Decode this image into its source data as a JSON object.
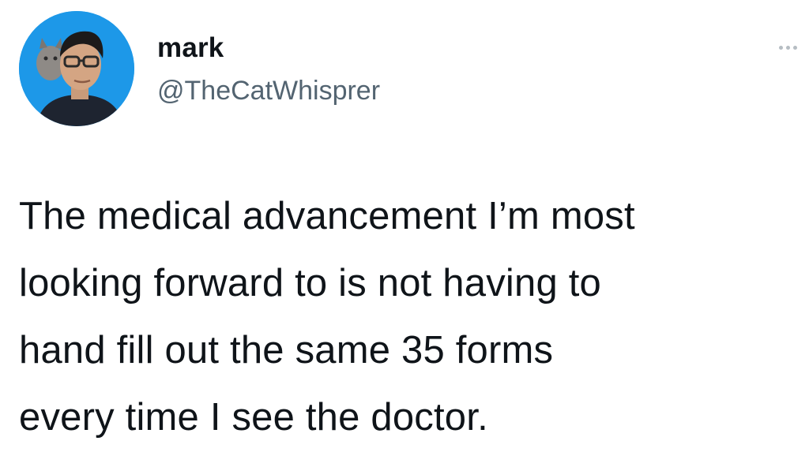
{
  "tweet": {
    "author": {
      "display_name": "mark",
      "handle": "@TheCatWhisprer",
      "avatar_icon": "profile-photo",
      "avatar_bg_color": "#1d98e8"
    },
    "more_icon": "more-options-icon",
    "text_lines": [
      "The medical advancement I’m most",
      "looking forward to is not having to",
      "hand fill out the same 35 forms",
      "every time I see the doctor."
    ]
  },
  "colors": {
    "text": "#0f1419",
    "secondary_text": "#536471",
    "background": "#ffffff"
  }
}
